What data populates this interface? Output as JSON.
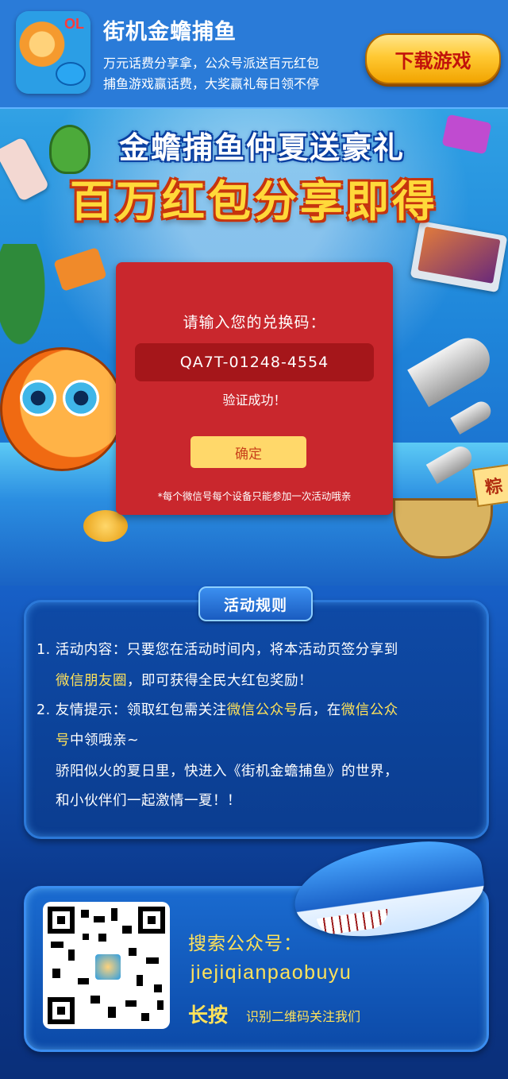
{
  "header": {
    "app_title": "街机金蟾捕鱼",
    "subtitle_line1": "万元话费分享拿，公众号派送百元红包",
    "subtitle_line2": "捕鱼游戏赢话费，大奖赢礼每日领不停",
    "download_label": "下载游戏",
    "icon_text": "OL"
  },
  "hero": {
    "headline1": "金蟾捕鱼仲夏送豪礼",
    "headline2": "百万红包分享即得",
    "flag_text": "粽"
  },
  "redeem": {
    "prompt": "请输入您的兑换码：",
    "code": "QA7T-01248-4554",
    "status": "验证成功！",
    "confirm_label": "确定",
    "note": "*每个微信号每个设备只能参加一次活动哦亲"
  },
  "rules": {
    "title": "活动规则",
    "r1_a": "1. 活动内容：只要您在活动时间内，将本活动页签分享到",
    "r1_b_hl": "微信朋友圈",
    "r1_b": "，即可获得全民大红包奖励！",
    "r2_a": "2. 友情提示：领取红包需关注",
    "r2_a_hl1": "微信公众号",
    "r2_a_mid": "后，在",
    "r2_a_hl2": "微信公众",
    "r2_b_hl": "号",
    "r2_b": "中领哦亲~",
    "r3": "骄阳似火的夏日里，快进入《街机金蟾捕鱼》的世界，",
    "r4": "和小伙伴们一起激情一夏！！"
  },
  "follow": {
    "label": "搜索公众号：",
    "account_id": "jiejiqianpaobuyu",
    "long_press": "长按",
    "note": "识别二维码关注我们"
  },
  "colors": {
    "top_bar": "#2a7bd8",
    "redeem_panel": "#c9272d",
    "code_box": "#a5161a",
    "confirm_button": "#ffd86a",
    "highlight_text": "#ffe25a",
    "download_button": "#ffc933"
  }
}
